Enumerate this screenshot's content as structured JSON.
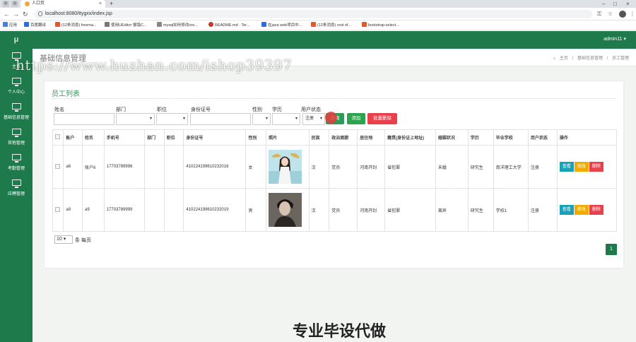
{
  "browser": {
    "tab_title": "人口页",
    "url": "localhost:8080/ttygxx/index.jsp",
    "bookmarks": [
      "应用",
      "百度翻译",
      "(12条消息) freema...",
      "使用UEditor 报错C...",
      "mysql如何修改roo...",
      "README.md · Ter...",
      "在java web项目中...",
      "(12条消息) root of...",
      "bootstrap-select..."
    ]
  },
  "app": {
    "logo": "μ",
    "user": "admin11 ▾"
  },
  "sidebar": {
    "items": [
      {
        "label": "主页"
      },
      {
        "label": "个人中心"
      },
      {
        "label": "基础信息管理"
      },
      {
        "label": "其他管理"
      },
      {
        "label": "考勤管理"
      },
      {
        "label": "应聘管理"
      }
    ]
  },
  "page": {
    "title": "基础信息管理",
    "breadcrumb": [
      "主页",
      "基础信息管理",
      "员工管理"
    ]
  },
  "watermark": "https://www.huzhan.com/ishop39397",
  "card": {
    "title": "员工列表",
    "filters": {
      "name_label": "姓名",
      "dept_label": "部门",
      "position_label": "职位",
      "id_label": "身份证号",
      "gender_label": "性别",
      "edu_label": "学历",
      "status_label": "用户状态",
      "status_value": "注册"
    },
    "buttons": {
      "search": "查询",
      "add": "添加",
      "batch_delete": "批量删除"
    },
    "table": {
      "headers": [
        "账户",
        "姓名",
        "手机号",
        "部门",
        "职位",
        "身份证号",
        "性别",
        "照片",
        "民族",
        "政治面貌",
        "居住地",
        "籍贯(身份证上地址)",
        "婚姻状况",
        "学历",
        "毕业学校",
        "用户状态",
        "操作"
      ],
      "rows": [
        {
          "account": "a6",
          "name": "账户6",
          "phone": "17703789996",
          "dept": "",
          "position": "",
          "idcard": "410224199610232016",
          "gender": "女",
          "ethnic": "汉",
          "political": "党员",
          "residence": "河南开封",
          "origin": "省犯罪",
          "marital": "未婚",
          "education": "研究生",
          "school": "南洋理工大学",
          "status": "注册"
        },
        {
          "account": "a9",
          "name": "a9",
          "phone": "17703789999",
          "dept": "",
          "position": "",
          "idcard": "410224199610232019",
          "gender": "男",
          "ethnic": "汉",
          "political": "党员",
          "residence": "河南开封",
          "origin": "省犯罪",
          "marital": "离异",
          "education": "研究生",
          "school": "学校1",
          "status": "注册"
        }
      ],
      "actions": {
        "view": "查看",
        "edit": "修改",
        "delete": "删除"
      }
    },
    "pager": {
      "page_size": "10",
      "page_size_suffix": "条 每页",
      "current_page": "1"
    }
  },
  "overlay_text": "专业毕设代做",
  "colors": {
    "brand": "#1e7a4b",
    "accent_title": "#2d9c5a",
    "view": "#17a2b8",
    "edit": "#f0ad00",
    "delete": "#e8414d",
    "add": "#2ea44f"
  }
}
